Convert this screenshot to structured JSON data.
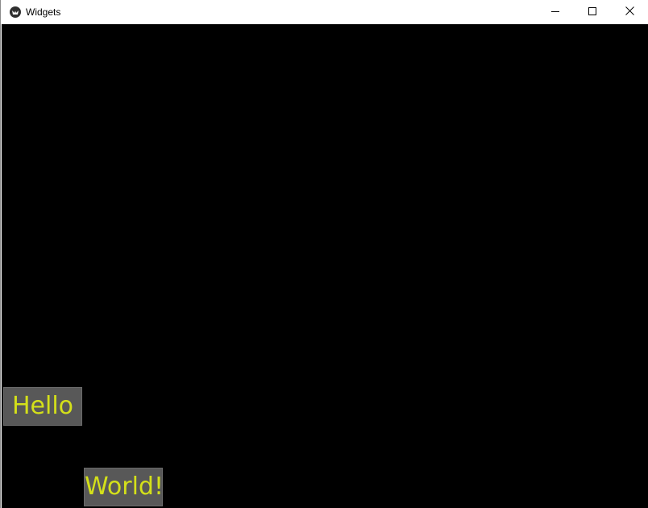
{
  "window": {
    "title": "Widgets",
    "app_icon": "kivy-logo-icon",
    "controls": {
      "minimize_icon": "minimize-icon",
      "maximize_icon": "maximize-icon",
      "close_icon": "close-icon"
    }
  },
  "canvas": {
    "background": "#000000"
  },
  "buttons": {
    "hello": "Hello",
    "world": "World!",
    "text_color": "#d4e01a",
    "background": "#585858"
  }
}
